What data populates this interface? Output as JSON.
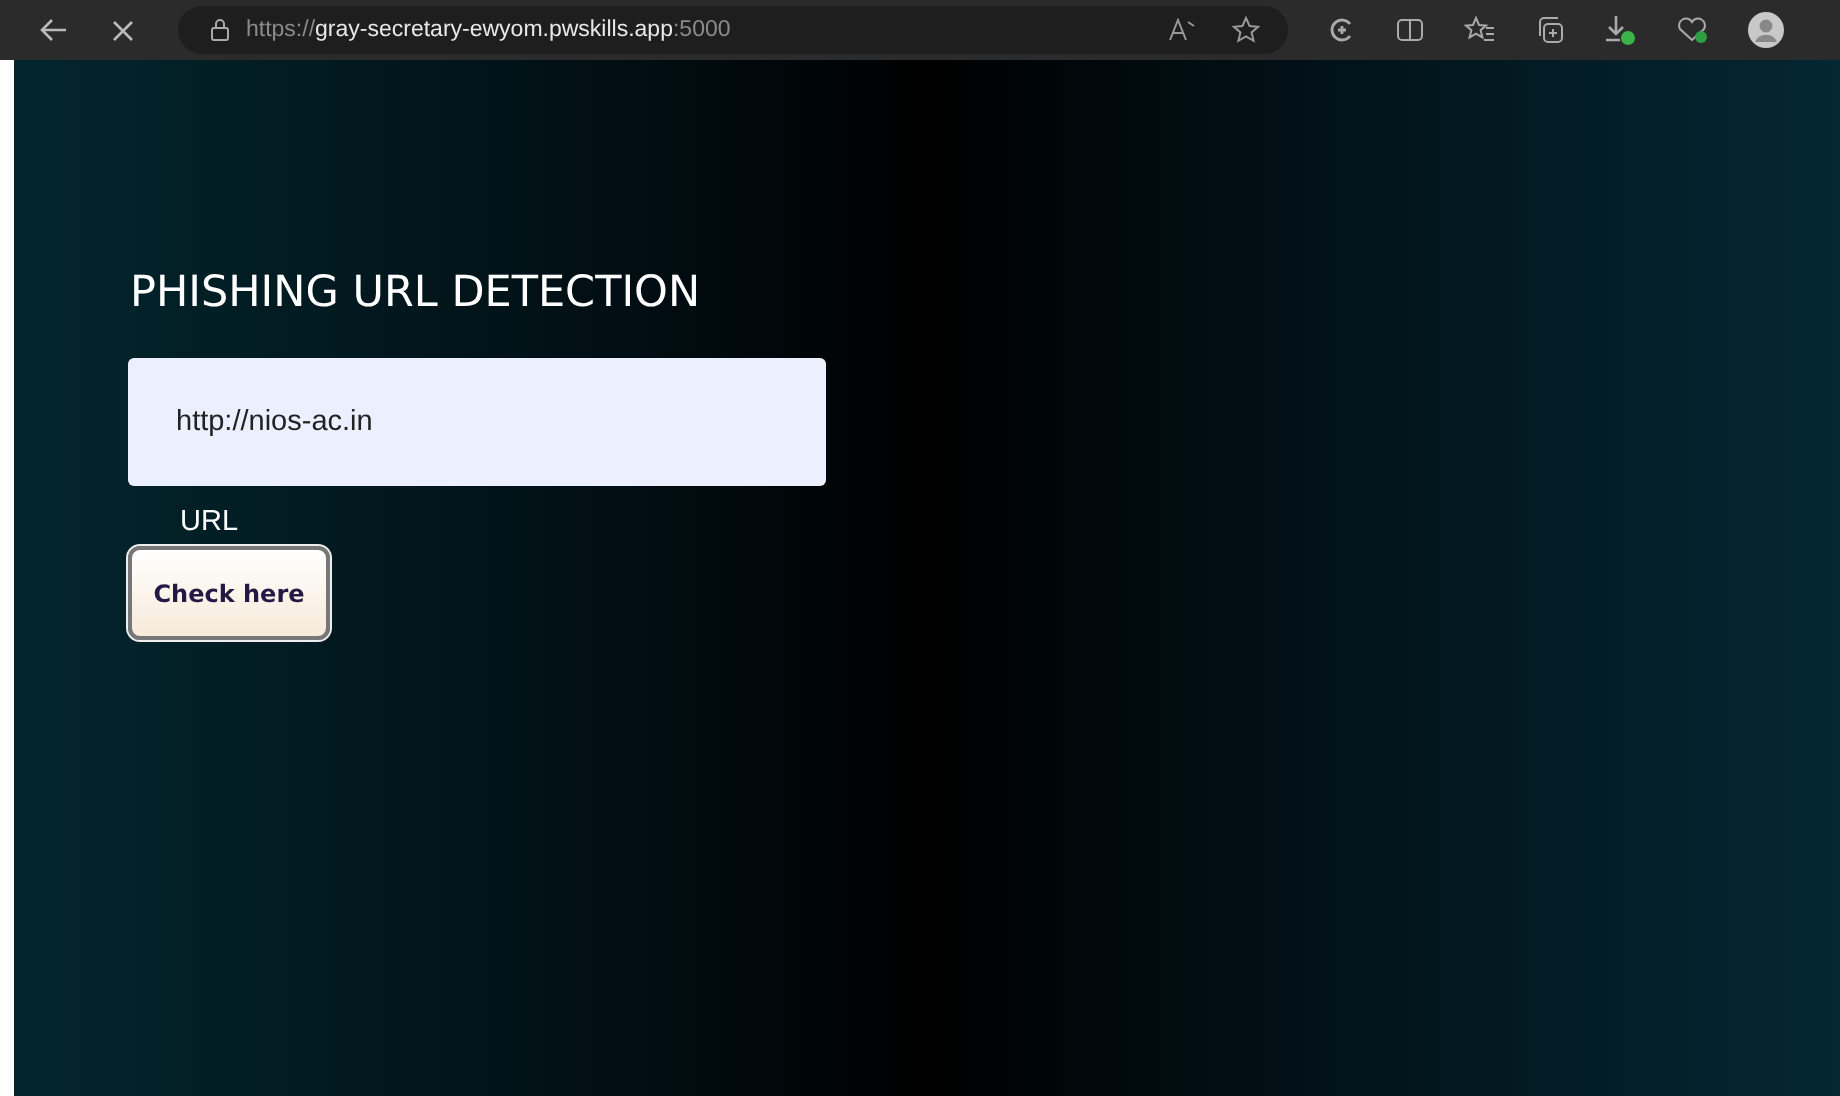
{
  "browser": {
    "address": {
      "scheme": "https://",
      "host": "gray-secretary-ewyom.pwskills.app",
      "port": ":5000"
    }
  },
  "page": {
    "heading": "PHISHING URL DETECTION",
    "url_field": {
      "value": "http://nios-ac.in",
      "label": "URL"
    },
    "button": "Check here"
  }
}
